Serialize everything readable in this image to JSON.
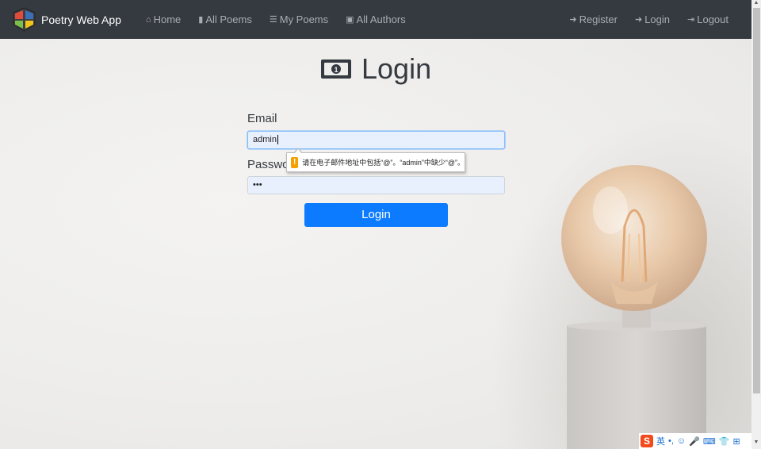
{
  "navbar": {
    "brand": "Poetry Web App",
    "left_links": [
      {
        "icon": "home-icon",
        "glyph": "⌂",
        "label": "Home"
      },
      {
        "icon": "book-icon",
        "glyph": "▮",
        "label": "All Poems"
      },
      {
        "icon": "list-icon",
        "glyph": "☰",
        "label": "My Poems"
      },
      {
        "icon": "money-icon",
        "glyph": "▣",
        "label": "All Authors"
      }
    ],
    "right_links": [
      {
        "icon": "sign-in-icon",
        "glyph": "➜",
        "label": "Register"
      },
      {
        "icon": "sign-in-icon",
        "glyph": "➜",
        "label": "Login"
      },
      {
        "icon": "sign-out-icon",
        "glyph": "⇥",
        "label": "Logout"
      }
    ]
  },
  "page": {
    "title": "Login"
  },
  "form": {
    "email_label": "Email",
    "email_value": "admin",
    "password_label": "Password",
    "password_value": "•••",
    "submit_label": "Login"
  },
  "validation": {
    "icon": "!",
    "message": "请在电子邮件地址中包括“@”。“admin”中缺少“@”。"
  },
  "ime": {
    "logo": "S",
    "mode": "英",
    "items": [
      "•,",
      "☺",
      "🎤",
      "⌨",
      "👕",
      "⊞"
    ]
  },
  "colors": {
    "navbar_bg": "#343a40",
    "primary": "#0d7bff",
    "warning": "#f5a000"
  }
}
